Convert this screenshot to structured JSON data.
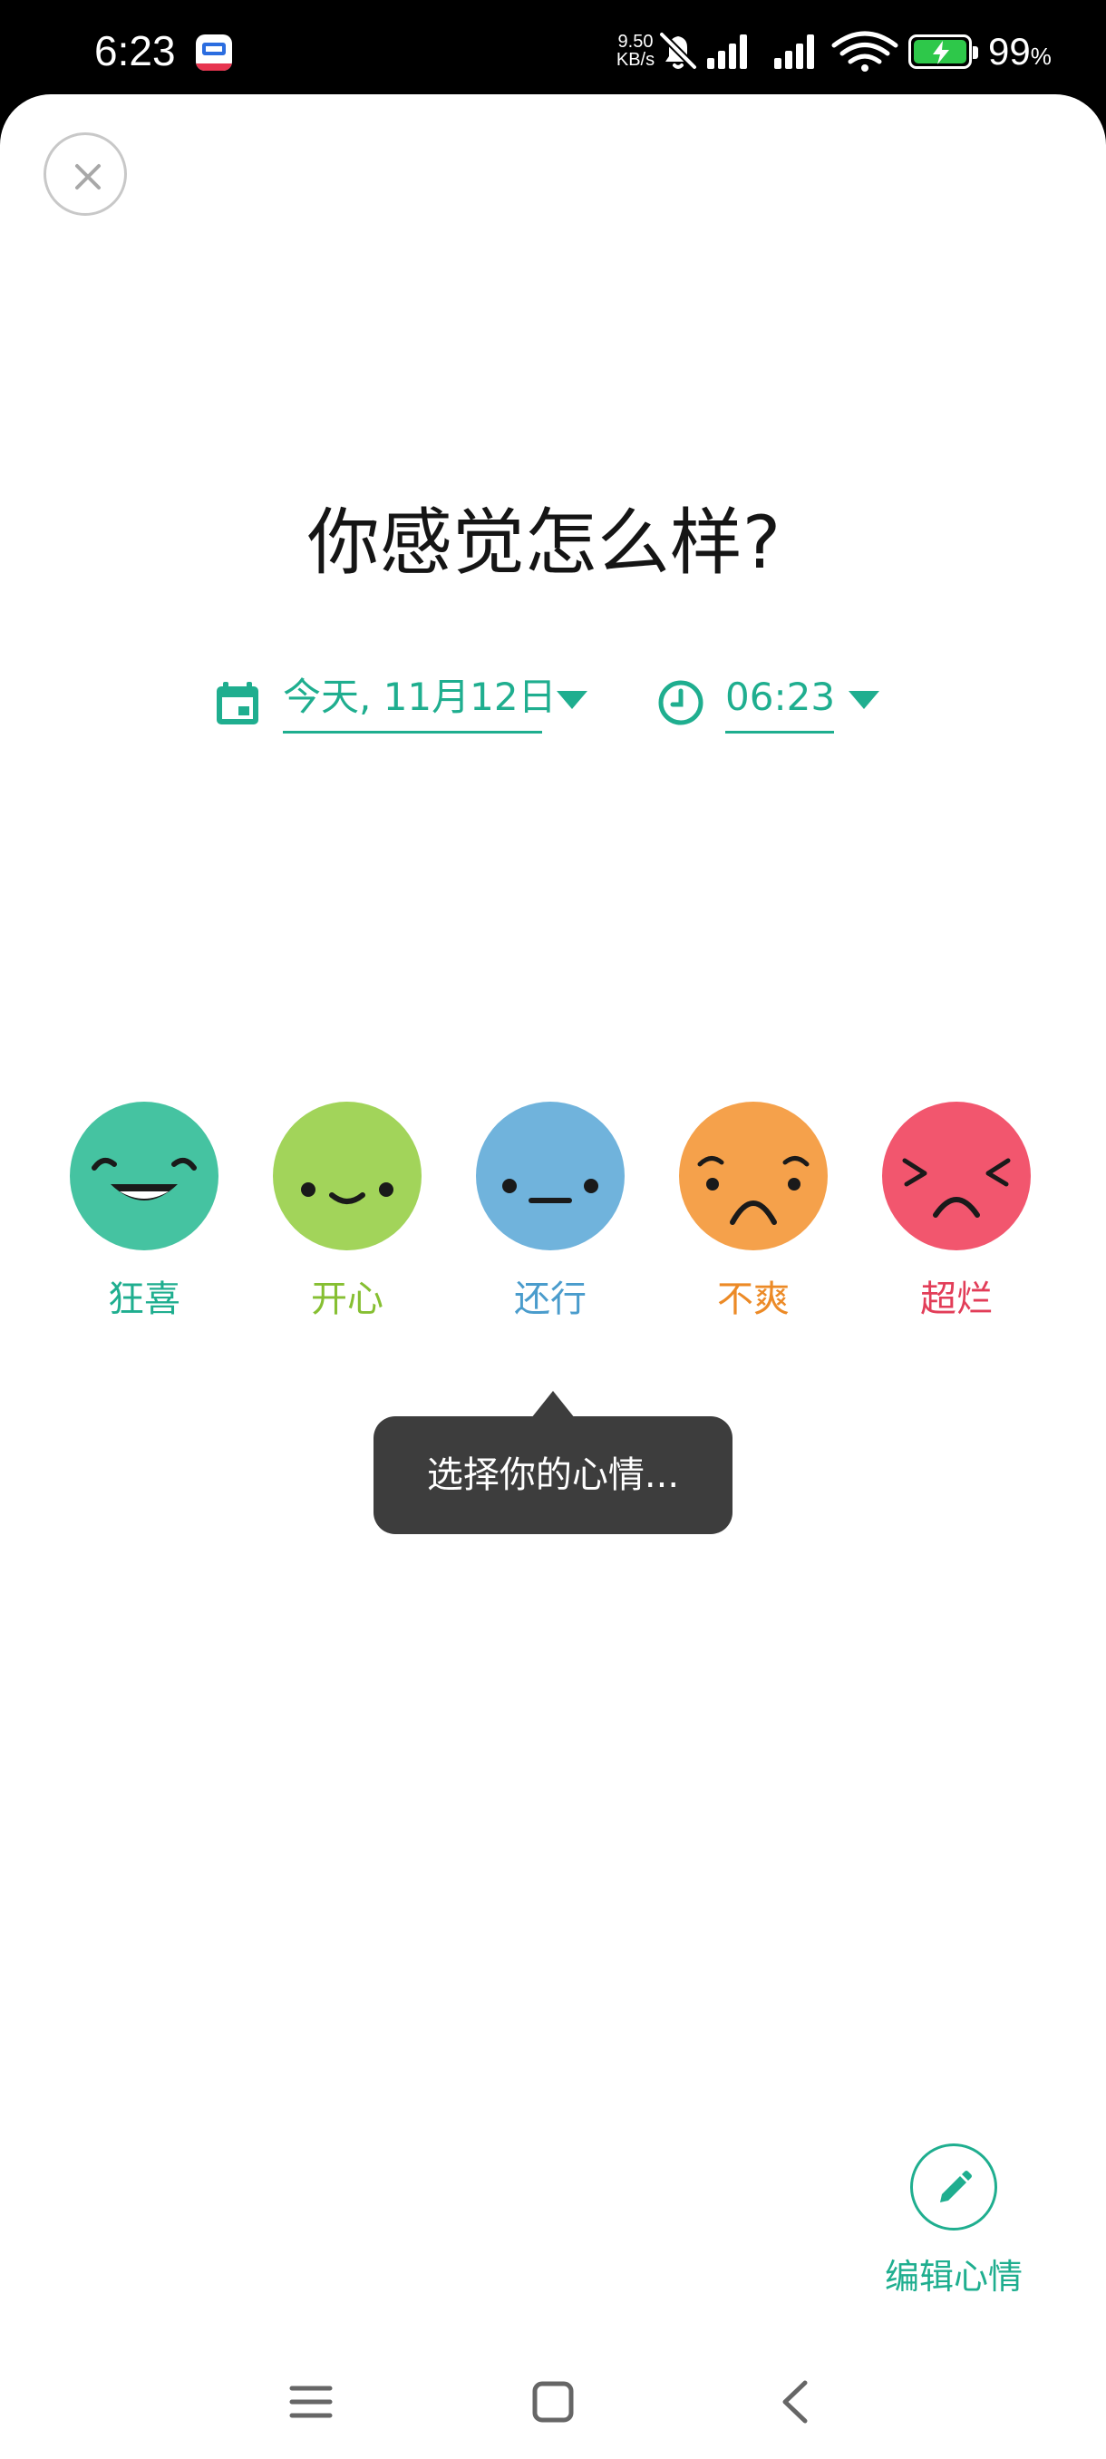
{
  "status_bar": {
    "time": "6:23",
    "net_speed_value": "9.50",
    "net_speed_unit": "KB/s",
    "battery_percent": "99",
    "battery_suffix": "%",
    "icons": [
      "app-notification-icon",
      "mute-icon",
      "signal-icon",
      "signal-icon",
      "wifi-icon",
      "battery-charging-icon"
    ]
  },
  "header": {
    "close_icon": "close-icon"
  },
  "main": {
    "title": "你感觉怎么样?",
    "date_label": "今天, 11月12日",
    "time_label": "06:23",
    "moods": [
      {
        "label": "狂喜",
        "color": "#45c3a1",
        "label_color": "#1fae8f"
      },
      {
        "label": "开心",
        "color": "#a2d45a",
        "label_color": "#86bf32"
      },
      {
        "label": "还行",
        "color": "#70b3dc",
        "label_color": "#4a9ccc"
      },
      {
        "label": "不爽",
        "color": "#f5a14b",
        "label_color": "#ec8a26"
      },
      {
        "label": "超烂",
        "color": "#f2566e",
        "label_color": "#e23d58"
      }
    ],
    "tooltip": "选择你的心情..."
  },
  "fab": {
    "label": "编辑心情",
    "icon": "pencil-icon"
  },
  "nav": {
    "icons": [
      "menu-icon",
      "home-icon",
      "back-icon"
    ]
  },
  "colors": {
    "accent": "#1fae8f",
    "tooltip_bg": "#3d3d3d"
  }
}
